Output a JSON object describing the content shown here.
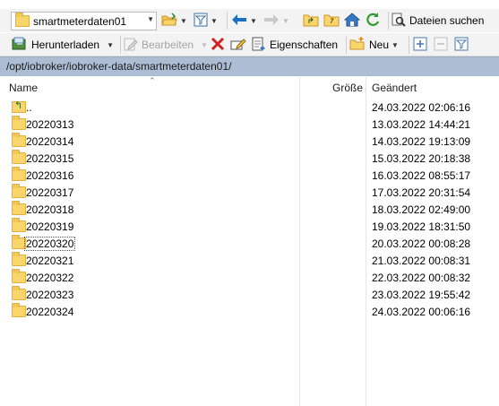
{
  "toolbar1": {
    "location_combo": "smartmeterdaten01",
    "find_files_label": "Dateien suchen"
  },
  "toolbar2": {
    "download_label": "Herunterladen",
    "edit_label": "Bearbeiten",
    "properties_label": "Eigenschaften",
    "new_label": "Neu"
  },
  "path": "/opt/iobroker/iobroker-data/smartmeterdaten01/",
  "columns": {
    "name": "Name",
    "size": "Größe",
    "changed": "Geändert"
  },
  "rows": [
    {
      "name": "..",
      "changed": "24.03.2022 02:06:16",
      "type": "parent"
    },
    {
      "name": "20220313",
      "changed": "13.03.2022 14:44:21",
      "type": "folder"
    },
    {
      "name": "20220314",
      "changed": "14.03.2022 19:13:09",
      "type": "folder"
    },
    {
      "name": "20220315",
      "changed": "15.03.2022 20:18:38",
      "type": "folder"
    },
    {
      "name": "20220316",
      "changed": "16.03.2022 08:55:17",
      "type": "folder"
    },
    {
      "name": "20220317",
      "changed": "17.03.2022 20:31:54",
      "type": "folder"
    },
    {
      "name": "20220318",
      "changed": "18.03.2022 02:49:00",
      "type": "folder"
    },
    {
      "name": "20220319",
      "changed": "19.03.2022 18:31:50",
      "type": "folder"
    },
    {
      "name": "20220320",
      "changed": "20.03.2022 00:08:28",
      "type": "folder",
      "focused": true
    },
    {
      "name": "20220321",
      "changed": "21.03.2022 00:08:31",
      "type": "folder"
    },
    {
      "name": "20220322",
      "changed": "22.03.2022 00:08:32",
      "type": "folder"
    },
    {
      "name": "20220323",
      "changed": "23.03.2022 19:55:42",
      "type": "folder"
    },
    {
      "name": "20220324",
      "changed": "24.03.2022 00:06:16",
      "type": "folder"
    }
  ],
  "colors": {
    "path_bar": "#adbdd4",
    "folder": "#f9d56b",
    "accent_blue": "#1f6fc5"
  }
}
